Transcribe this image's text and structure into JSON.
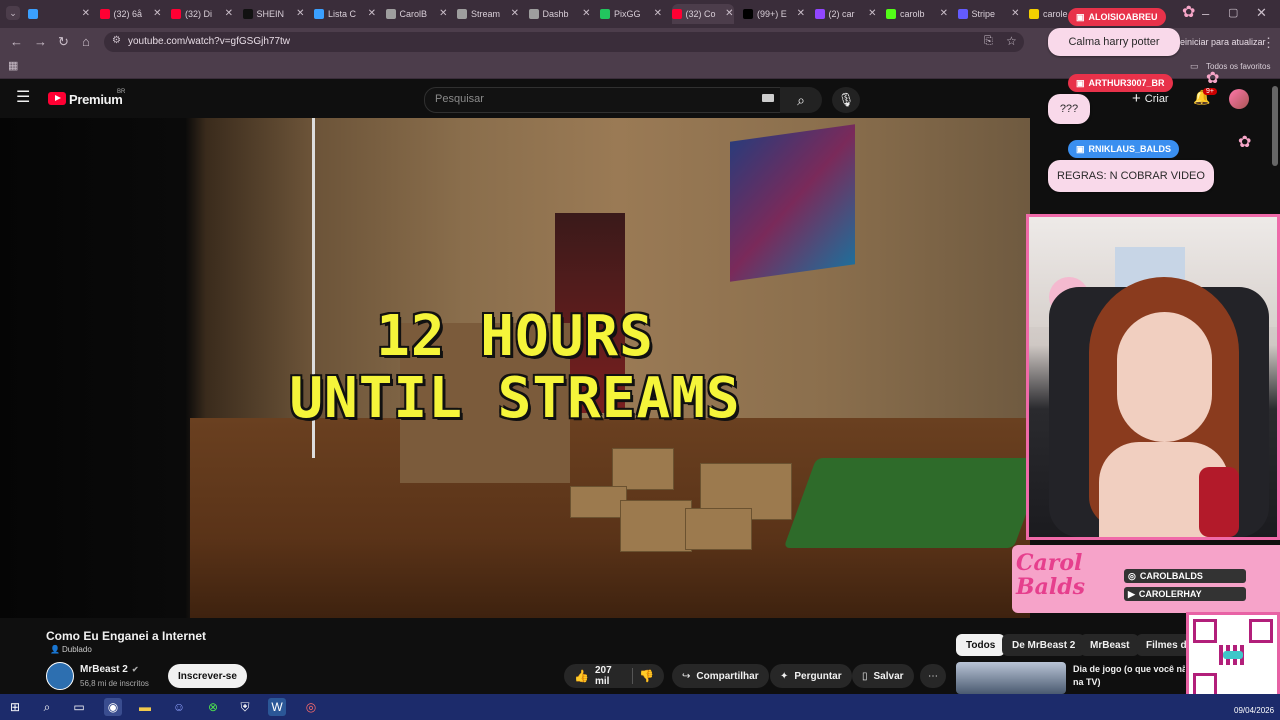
{
  "browser": {
    "tabs": [
      {
        "label": "",
        "color": "#3aa0ff"
      },
      {
        "label": "(32) 6å",
        "color": "#ff0033"
      },
      {
        "label": "(32) Di",
        "color": "#ff0033"
      },
      {
        "label": "SHEIN",
        "color": "#111111"
      },
      {
        "label": "Lista C",
        "color": "#3aa0ff"
      },
      {
        "label": "CarolB",
        "color": "#9e9e9e"
      },
      {
        "label": "Stream",
        "color": "#9e9e9e"
      },
      {
        "label": "Dashb",
        "color": "#9e9e9e"
      },
      {
        "label": "PixGG",
        "color": "#22c55e"
      },
      {
        "label": "(32) Co",
        "color": "#ff0033"
      },
      {
        "label": "(99+) E",
        "color": "#000000"
      },
      {
        "label": "(2) car",
        "color": "#9146ff"
      },
      {
        "label": "carolb",
        "color": "#53fc18"
      },
      {
        "label": "Stripe",
        "color": "#635bff"
      },
      {
        "label": "carole",
        "color": "#f5d000"
      }
    ],
    "url": "youtube.com/watch?v=gfGSGjh77tw",
    "update_text": "einiciar para atualizar",
    "bookmarks_label": "Todos os favoritos"
  },
  "youtube": {
    "logo": "Premium",
    "logo_region": "BR",
    "search_placeholder": "Pesquisar",
    "create_label": "Criar",
    "notif_count": "9+"
  },
  "video": {
    "overlay_line1": "12 HOURS",
    "overlay_line2": "UNTIL STREAMS",
    "title": "Como Eu Enganei a Internet",
    "dubbed_label": "Dublado",
    "channel_name": "MrBeast 2",
    "subscribers": "56,8 mi de inscritos",
    "subscribe_label": "Inscrever-se",
    "likes": "207 mil",
    "share_label": "Compartilhar",
    "ask_label": "Perguntar",
    "save_label": "Salvar"
  },
  "recommendations": {
    "chips": [
      "Todos",
      "De MrBeast 2",
      "MrBeast",
      "Filmes de"
    ],
    "first_title_line1": "Dia de jogo (o que você nã",
    "first_title_line2": "na TV)"
  },
  "stream_overlay": {
    "chat": [
      {
        "user": "ALOISIOABREU",
        "message": "Calma harry potter",
        "badge_color": "#e8324a"
      },
      {
        "user": "ARTHUR3007_BR",
        "message": "???",
        "badge_color": "#e8324a"
      },
      {
        "user": "RNIKLAUS_BALDS",
        "message": "REGRAS: N COBRAR VIDEO",
        "badge_color": "#3a8ff0"
      }
    ],
    "brand_name": "Carol Balds",
    "socials": [
      "CAROLBALDS",
      "CAROLERHAY"
    ]
  },
  "taskbar": {
    "date": "09/04/2026"
  }
}
